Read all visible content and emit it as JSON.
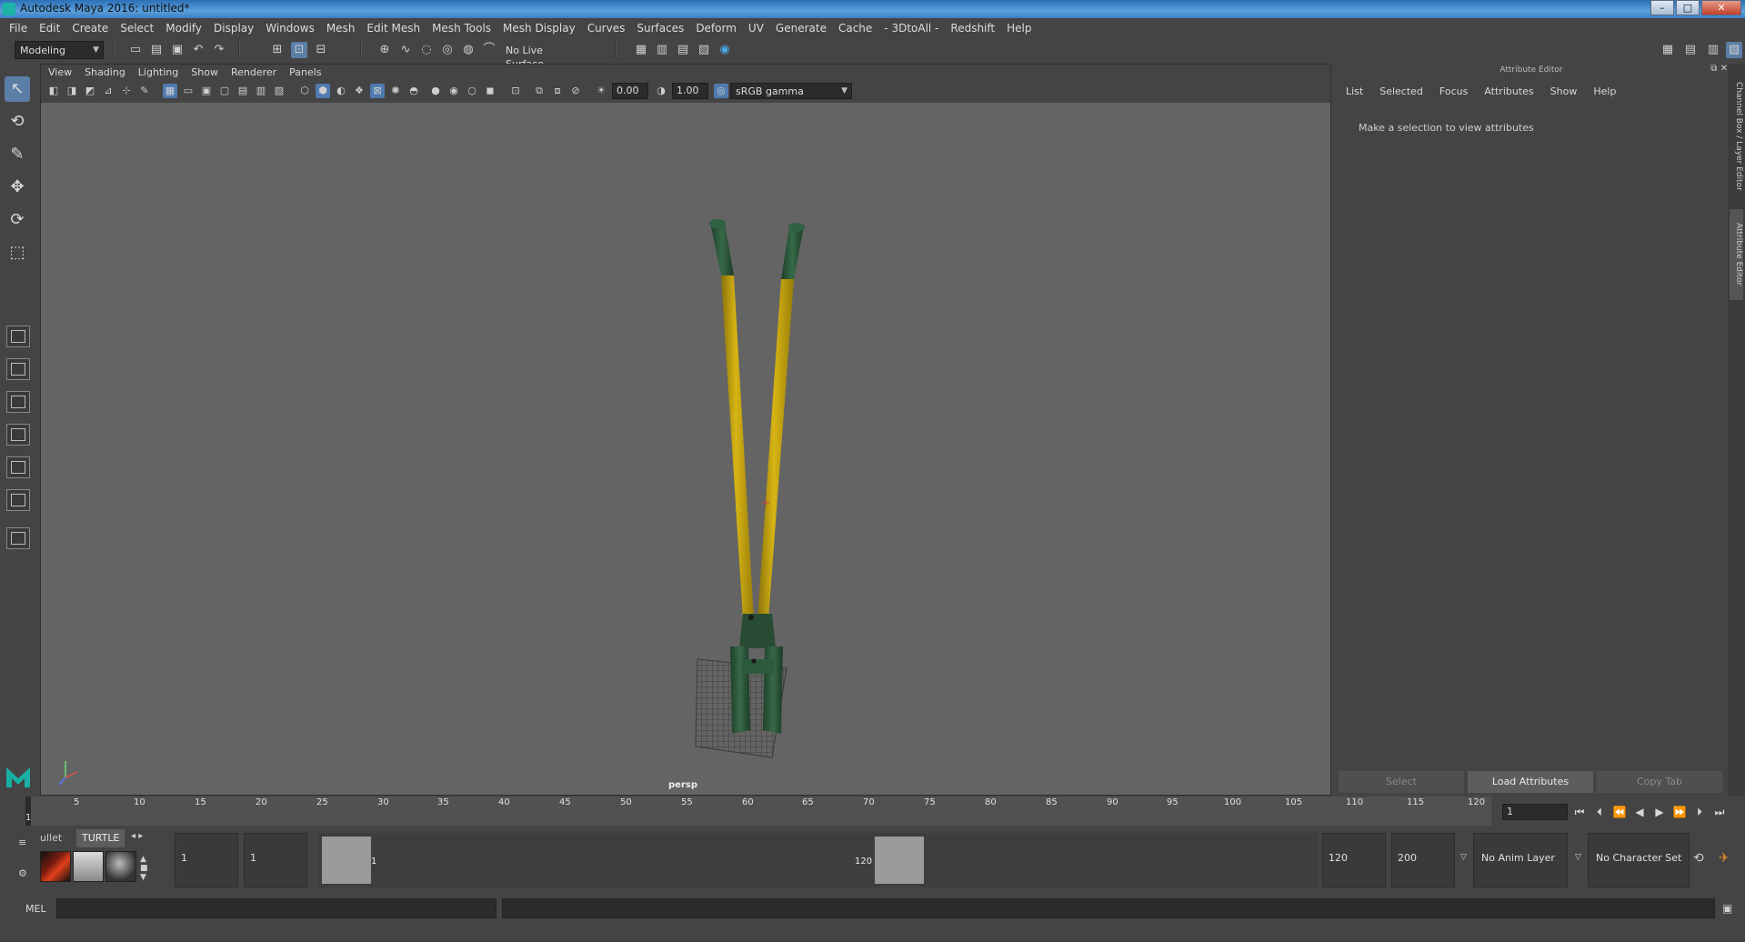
{
  "window": {
    "title": "Autodesk Maya 2016: untitled*",
    "btn_min": "–",
    "btn_max": "□",
    "btn_close": "✕"
  },
  "menubar": [
    "File",
    "Edit",
    "Create",
    "Select",
    "Modify",
    "Display",
    "Windows",
    "Mesh",
    "Edit Mesh",
    "Mesh Tools",
    "Mesh Display",
    "Curves",
    "Surfaces",
    "Deform",
    "UV",
    "Generate",
    "Cache",
    "- 3DtoAll -",
    "Redshift",
    "Help"
  ],
  "statusline": {
    "menuset": "Modeling",
    "live_surface": "No Live Surface"
  },
  "viewport": {
    "menu": [
      "View",
      "Shading",
      "Lighting",
      "Show",
      "Renderer",
      "Panels"
    ],
    "exposure": "0.00",
    "gamma": "1.00",
    "color_space": "sRGB gamma",
    "camera": "persp"
  },
  "attribute_editor": {
    "header": "Attribute Editor",
    "menu": [
      "List",
      "Selected",
      "Focus",
      "Attributes",
      "Show",
      "Help"
    ],
    "message": "Make a selection to view attributes",
    "buttons": {
      "select": "Select",
      "load": "Load Attributes",
      "copy": "Copy Tab"
    }
  },
  "side_tabs": {
    "channel_box": "Channel Box / Layer Editor",
    "attribute_editor": "Attribute Editor"
  },
  "time_slider": {
    "ticks": [
      "1",
      "5",
      "10",
      "15",
      "20",
      "25",
      "30",
      "35",
      "40",
      "45",
      "50",
      "55",
      "60",
      "65",
      "70",
      "75",
      "80",
      "85",
      "90",
      "95",
      "100",
      "105",
      "110",
      "115",
      "120"
    ],
    "current_frame": "1"
  },
  "shelf": {
    "tabs": [
      "ullet",
      "TURTLE"
    ],
    "mel_label": "MEL"
  },
  "range": {
    "anim_start": "1",
    "range_start": "1",
    "handle_start": "1",
    "handle_end": "120",
    "range_end": "120",
    "anim_end": "200",
    "anim_layer": "No Anim Layer",
    "character_set": "No Character Set"
  },
  "colors": {
    "accent": "#5a7ea6",
    "handle_yellow": "#c9a713",
    "grip_green": "#2c5a3d",
    "viewport_bg": "#646464"
  }
}
